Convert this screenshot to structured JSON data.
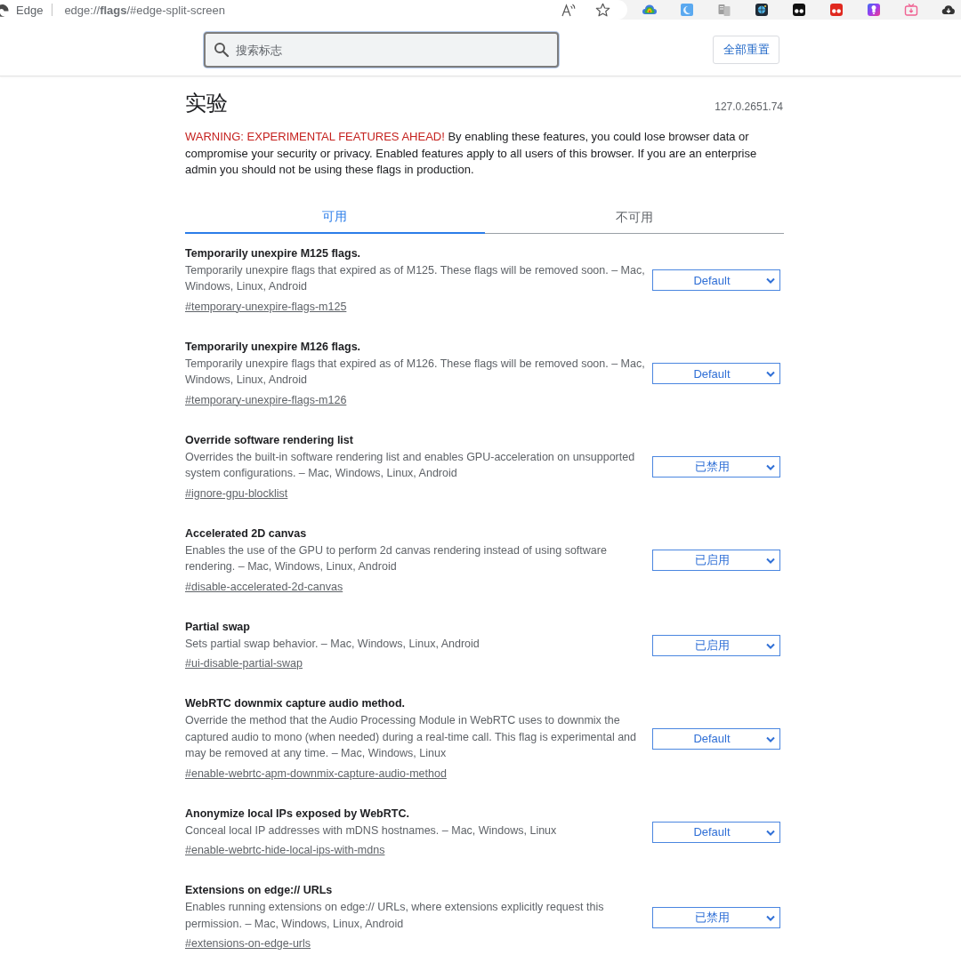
{
  "browser": {
    "app_name": "Edge",
    "address": "edge://**flags**/#edge-split-screen"
  },
  "header": {
    "search": {
      "placeholder": "搜索标志"
    },
    "reset_button": "全部重置"
  },
  "page": {
    "title": "实验",
    "version": "127.0.2651.74",
    "warning": {
      "alert": "WARNING: EXPERIMENTAL FEATURES AHEAD!",
      "text": "By enabling these features, you could lose browser data or compromise your security or privacy. Enabled features apply to all users of this browser. If you are an enterprise admin you should not be using these flags in production."
    }
  },
  "tabs": [
    {
      "label": "可用",
      "selected": true
    },
    {
      "label": "不可用",
      "selected": false
    }
  ],
  "flags": [
    {
      "title": "Temporarily unexpire M125 flags.",
      "description": "Temporarily unexpire flags that expired as of M125. These flags will be removed soon. – Mac, Windows, Linux, Android",
      "link": "#temporary-unexpire-flags-m125",
      "value": "Default"
    },
    {
      "title": "Temporarily unexpire M126 flags.",
      "description": "Temporarily unexpire flags that expired as of M126. These flags will be removed soon. – Mac, Windows, Linux, Android",
      "link": "#temporary-unexpire-flags-m126",
      "value": "Default"
    },
    {
      "title": "Override software rendering list",
      "description": "Overrides the built-in software rendering list and enables GPU-acceleration on unsupported system configurations. – Mac, Windows, Linux, Android",
      "link": "#ignore-gpu-blocklist",
      "value": "已禁用"
    },
    {
      "title": "Accelerated 2D canvas",
      "description": "Enables the use of the GPU to perform 2d canvas rendering instead of using software rendering. – Mac, Windows, Linux, Android",
      "link": "#disable-accelerated-2d-canvas",
      "value": "已启用"
    },
    {
      "title": "Partial swap",
      "description": "Sets partial swap behavior. – Mac, Windows, Linux, Android",
      "link": "#ui-disable-partial-swap",
      "value": "已启用"
    },
    {
      "title": "WebRTC downmix capture audio method.",
      "description": "Override the method that the Audio Processing Module in WebRTC uses to downmix the captured audio to mono (when needed) during a real-time call. This flag is experimental and may be removed at any time. – Mac, Windows, Linux",
      "link": "#enable-webrtc-apm-downmix-capture-audio-method",
      "value": "Default"
    },
    {
      "title": "Anonymize local IPs exposed by WebRTC.",
      "description": "Conceal local IP addresses with mDNS hostnames. – Mac, Windows, Linux",
      "link": "#enable-webrtc-hide-local-ips-with-mdns",
      "value": "Default"
    },
    {
      "title": "Extensions on edge:// URLs",
      "description": "Enables running extensions on edge:// URLs, where extensions explicitly request this permission. – Mac, Windows, Linux, Android",
      "link": "#extensions-on-edge-urls",
      "value": "已禁用"
    }
  ]
}
